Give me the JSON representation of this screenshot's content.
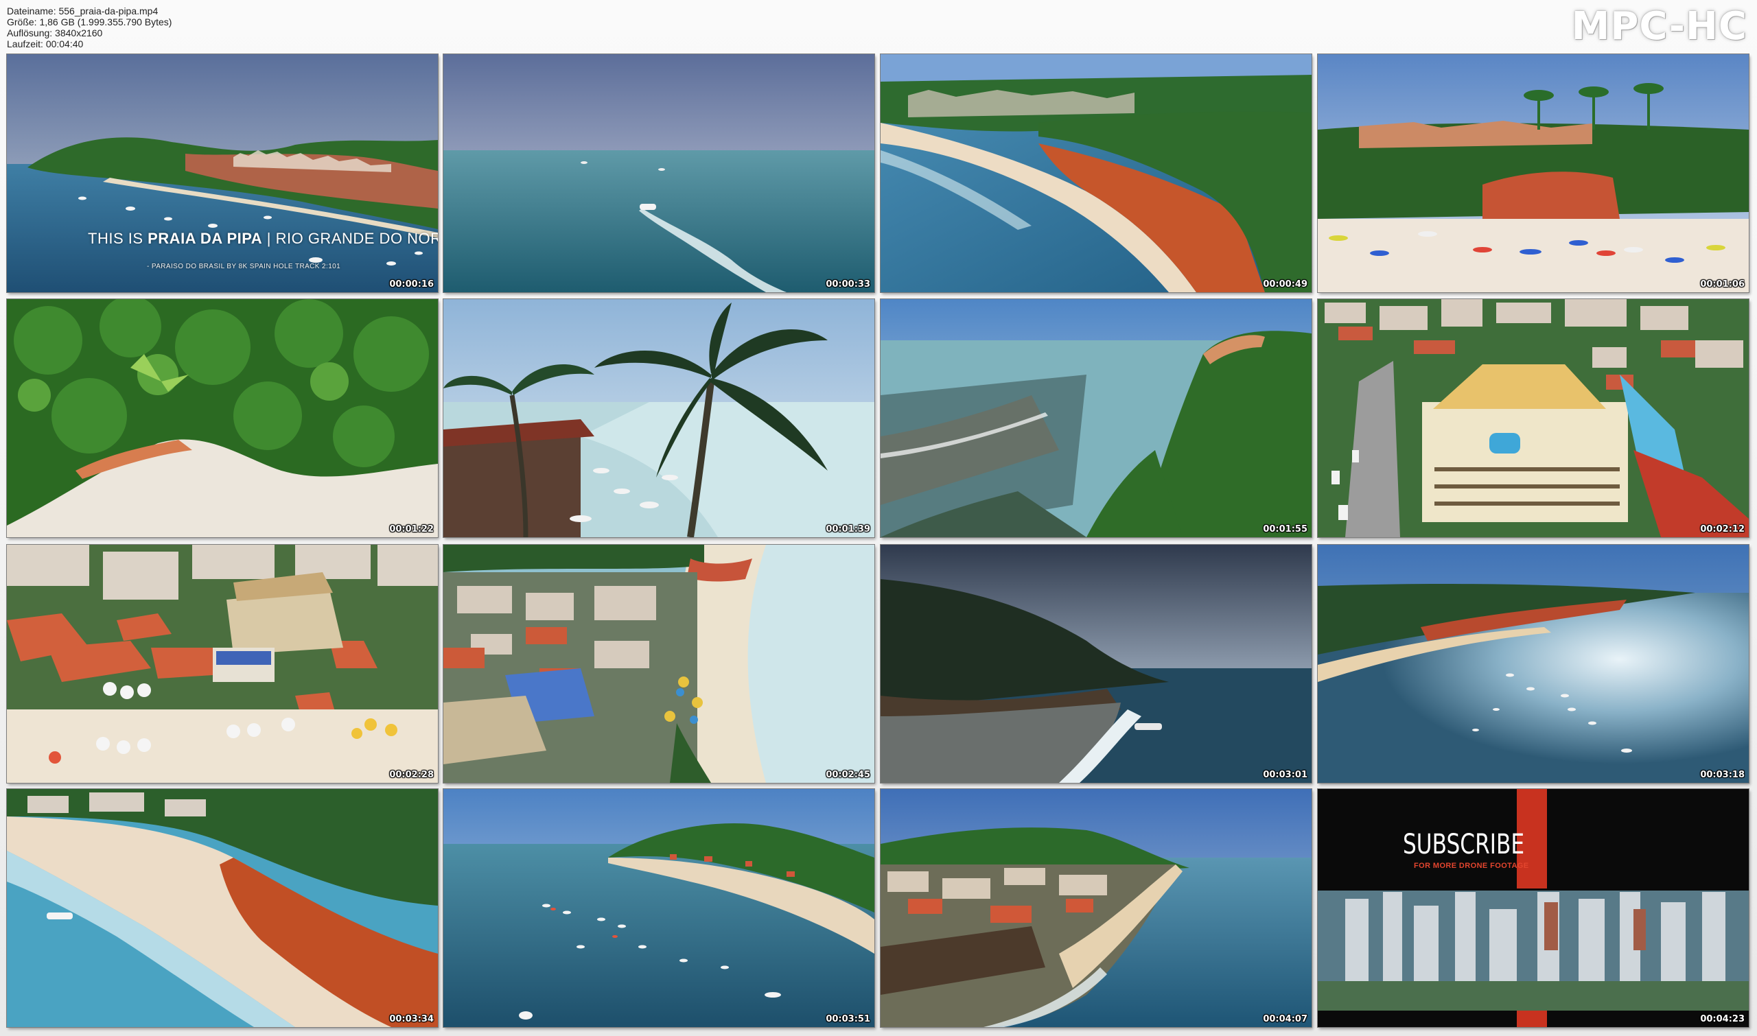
{
  "file_info": {
    "lines": [
      "Dateiname: 556_praia-da-pipa.mp4",
      "Größe: 1,86 GB (1.999.355.790 Bytes)",
      "Auflösung: 3840x2160",
      "Laufzeit: 00:04:40"
    ]
  },
  "brand": "MPC-HC",
  "overlay": {
    "title_lead": "THIS IS ",
    "title_bold": "PRAIA DA PIPA",
    "title_rest": " | RIO GRANDE DO NORTE",
    "subtitle": "- PARAISO DO BRASIL   BY 8K SPAIN HOLE TRACK 2:101"
  },
  "subscribe": {
    "title": "SUBSCRIBE",
    "caption": "FOR MORE DRONE FOOTAGE"
  },
  "thumbnails": [
    {
      "time": "00:00:16",
      "icon": "bay-village-scene"
    },
    {
      "time": "00:00:33",
      "icon": "speedboat-ocean-scene"
    },
    {
      "time": "00:00:49",
      "icon": "cliff-beach-scene"
    },
    {
      "time": "00:01:06",
      "icon": "beach-umbrellas-scene"
    },
    {
      "time": "00:01:22",
      "icon": "forest-beach-topdown-scene"
    },
    {
      "time": "00:01:39",
      "icon": "palm-tree-beach-scene"
    },
    {
      "time": "00:01:55",
      "icon": "green-headland-scene"
    },
    {
      "time": "00:02:12",
      "icon": "hotel-town-scene"
    },
    {
      "time": "00:02:28",
      "icon": "town-rooftops-scene"
    },
    {
      "time": "00:02:45",
      "icon": "town-beach-waves-scene"
    },
    {
      "time": "00:03:01",
      "icon": "dusk-beach-scene"
    },
    {
      "time": "00:03:18",
      "icon": "sunlit-bay-boats-scene"
    },
    {
      "time": "00:03:34",
      "icon": "red-cliff-shore-scene"
    },
    {
      "time": "00:03:51",
      "icon": "boats-bay-headland-scene"
    },
    {
      "time": "00:04:07",
      "icon": "beach-town-curve-scene"
    },
    {
      "time": "00:04:23",
      "icon": "subscribe-skyscrapers-scene"
    }
  ],
  "colors": {
    "ocean": "#2f6f8f",
    "sand": "#efe6d6",
    "forest": "#2f6a2a",
    "cliff": "#c0532d",
    "subscribe_red": "#c8321f"
  }
}
